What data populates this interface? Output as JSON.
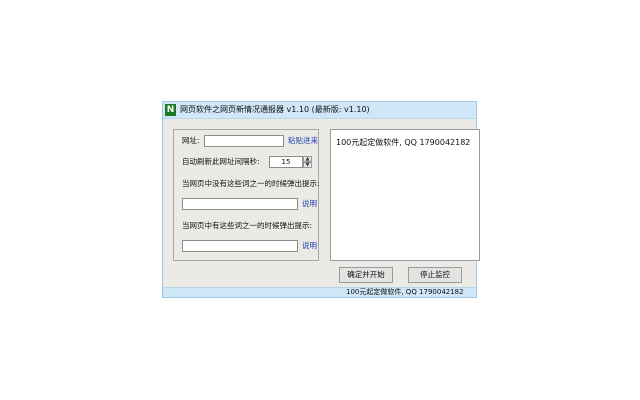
{
  "window": {
    "icon_letter": "N",
    "title": "网页软件之网页新情况通报器 v1.10 (最新版: v1.10)"
  },
  "form": {
    "url_label": "网址:",
    "url_value": "",
    "paste_link": "粘贴进来",
    "interval_label": "自动刷新此网址间隔秒:",
    "interval_value": "15",
    "absent_label": "当网页中没有这些词之一的时候弹出提示:",
    "absent_value": "",
    "absent_help": "说明",
    "present_label": "当网页中有这些词之一的时候弹出提示:",
    "present_value": "",
    "present_help": "说明"
  },
  "output_text": "100元起定做软件, QQ 1790042182",
  "buttons": {
    "start": "确定并开始",
    "stop": "停止监控"
  },
  "status": {
    "text": "100元起定做软件, QQ 1790042182"
  },
  "icons": {
    "app": "app-n-icon",
    "spin_up": "spin-up-arrow-icon",
    "spin_down": "spin-down-arrow-icon"
  }
}
